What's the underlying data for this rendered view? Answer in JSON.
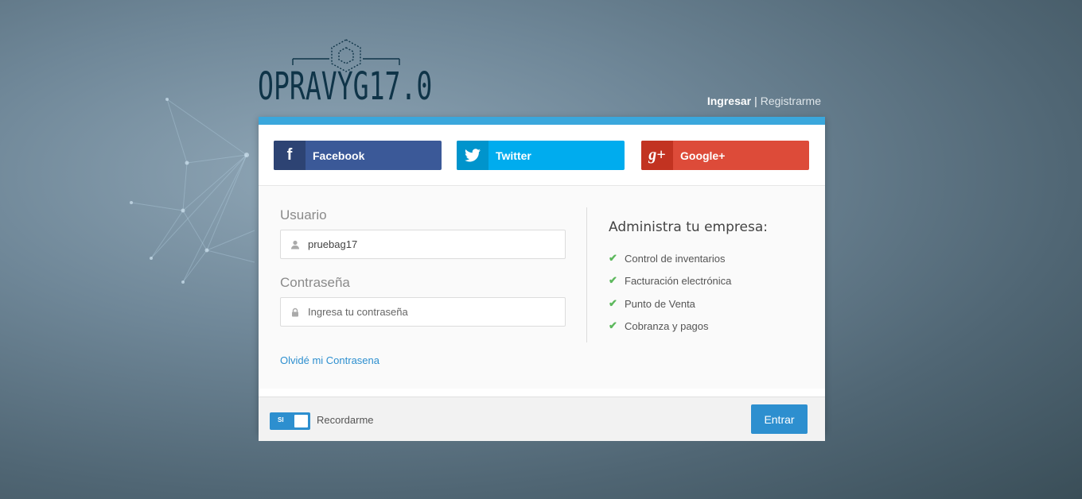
{
  "logo": {
    "text": "OPRAVYG17.0"
  },
  "auth": {
    "login": "Ingresar",
    "separator": "|",
    "register": "Registrarme"
  },
  "social": {
    "facebook": {
      "label": "Facebook",
      "icon": "f"
    },
    "twitter": {
      "label": "Twitter"
    },
    "google": {
      "label": "Google+",
      "icon": "g+"
    }
  },
  "form": {
    "user_label": "Usuario",
    "user_value": "pruebag17",
    "password_label": "Contraseña",
    "password_placeholder": "Ingresa tu contraseña",
    "forgot": "Olvidé mi Contrasena"
  },
  "info": {
    "title": "Administra tu empresa:",
    "features": [
      "Control de inventarios",
      "Facturación electrónica",
      "Punto de Venta",
      "Cobranza y pagos"
    ]
  },
  "footer": {
    "toggle_label": "SI",
    "remember": "Recordarme",
    "submit": "Entrar"
  },
  "colors": {
    "accent": "#3aa7dc",
    "primary": "#2d8fcf",
    "facebook": "#3b5998",
    "twitter": "#00acee",
    "google": "#dd4b39",
    "check": "#5cb85c"
  }
}
